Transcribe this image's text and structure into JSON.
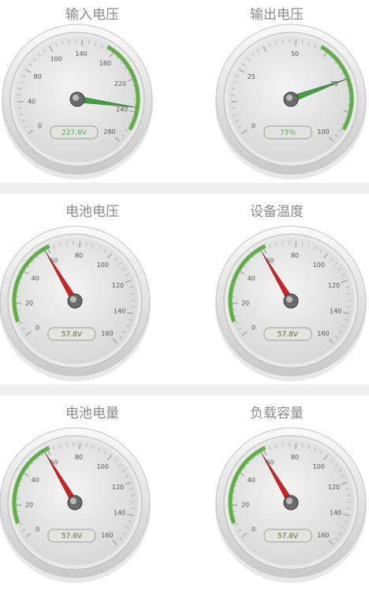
{
  "gauges": [
    {
      "title": "输入电压",
      "readout": "227.6V",
      "readout_color": "#4caf50",
      "needle_color": "#3aa43a",
      "tick_labels": [
        "0",
        "40",
        "80",
        "100",
        "140",
        "180",
        "220",
        "240",
        "280"
      ],
      "needle_value": 240
    },
    {
      "title": "输出电压",
      "readout": "75%",
      "readout_color": "#4caf50",
      "needle_color": "#3aa43a",
      "tick_labels": [
        "0",
        "25",
        "50",
        "75",
        "100"
      ],
      "needle_value": 75
    },
    {
      "title": "电池电压",
      "readout": "57.8V",
      "readout_color": "#6b6b3a",
      "needle_color": "#d42020",
      "tick_labels": [
        "0",
        "20",
        "40",
        "60",
        "80",
        "100",
        "120",
        "140",
        "160"
      ],
      "needle_value": 58
    },
    {
      "title": "设备温度",
      "readout": "57.8V",
      "readout_color": "#6b6b3a",
      "needle_color": "#d42020",
      "tick_labels": [
        "0",
        "20",
        "40",
        "60",
        "80",
        "100",
        "120",
        "140",
        "160"
      ],
      "needle_value": 58
    },
    {
      "title": "电池电量",
      "readout": "57.8V",
      "readout_color": "#6b6b3a",
      "needle_color": "#d42020",
      "tick_labels": [
        "0",
        "20",
        "40",
        "60",
        "80",
        "100",
        "120",
        "140",
        "160"
      ],
      "needle_value": 58
    },
    {
      "title": "负载容量",
      "readout": "57.8V",
      "readout_color": "#6b6b3a",
      "needle_color": "#d42020",
      "tick_labels": [
        "0",
        "20",
        "40",
        "60",
        "80",
        "100",
        "120",
        "140",
        "160"
      ],
      "needle_value": 58
    }
  ]
}
